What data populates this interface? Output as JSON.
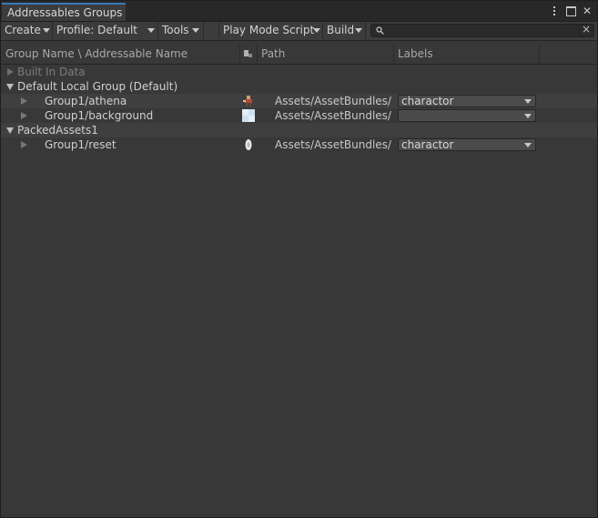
{
  "window": {
    "tab_title": "Addressables Groups"
  },
  "toolbar": {
    "create": "Create",
    "profile": "Profile: Default",
    "tools": "Tools",
    "play_mode_script": "Play Mode Script",
    "build": "Build",
    "search_value": ""
  },
  "columns": {
    "name": "Group Name \\ Addressable Name",
    "path": "Path",
    "labels": "Labels"
  },
  "tree": {
    "built_in": "Built In Data",
    "default_group": "Default Local Group (Default)",
    "entry_athena": {
      "name": "Group1/athena",
      "path": "Assets/AssetBundles/G",
      "label": "charactor",
      "icon": "character-sprite-icon"
    },
    "entry_background": {
      "name": "Group1/background",
      "path": "Assets/AssetBundles/G",
      "label": "",
      "icon": "texture-icon"
    },
    "packed_group": "PackedAssets1",
    "entry_reset": {
      "name": "Group1/reset",
      "path": "Assets/AssetBundles/G",
      "label": "charactor",
      "icon": "reset-sprite-icon"
    }
  },
  "colors": {
    "background": "#383838",
    "titlebar": "#282828",
    "tab_accent": "#3a79bb",
    "dropdown": "#4b4b4b"
  }
}
